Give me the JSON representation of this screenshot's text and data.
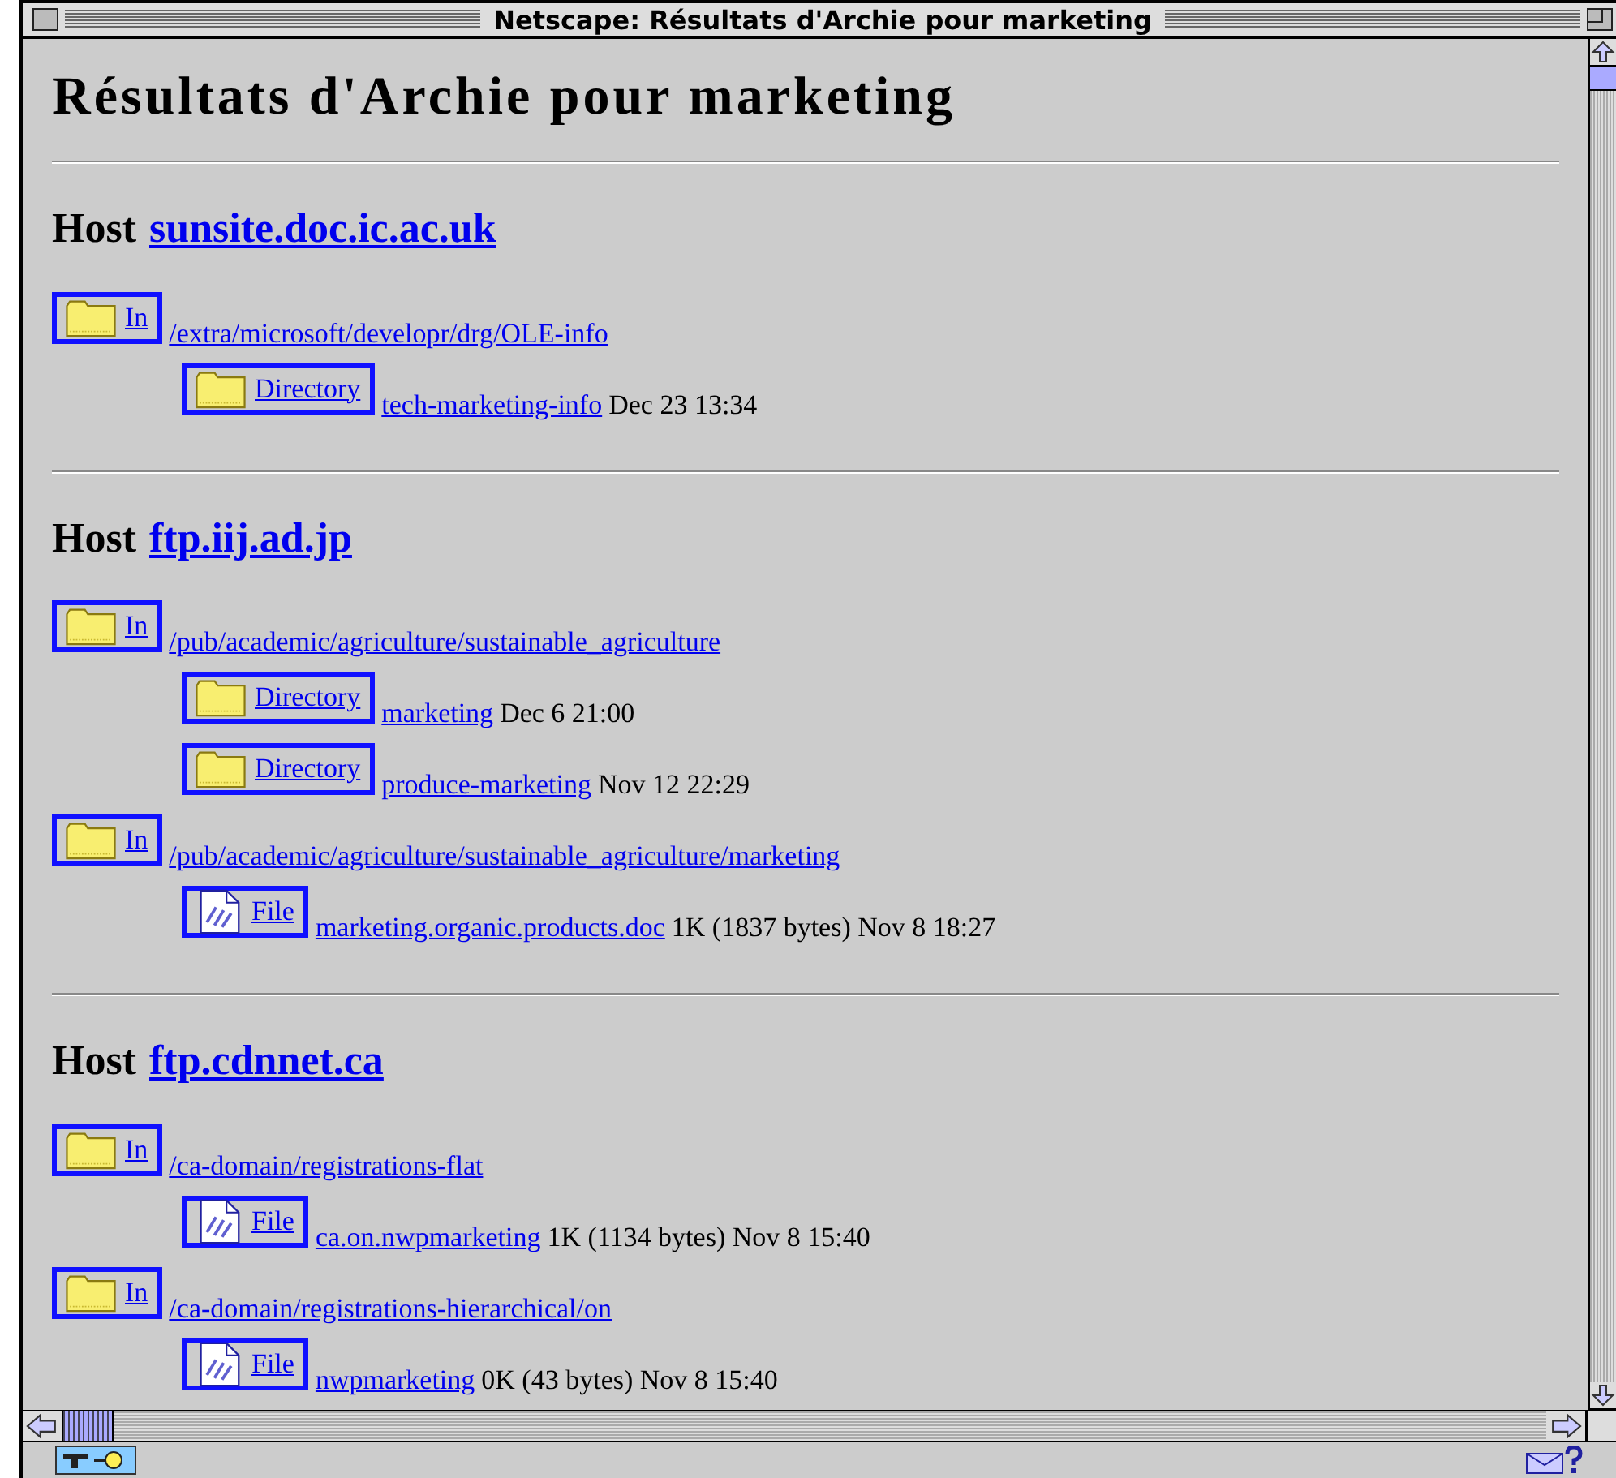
{
  "window": {
    "title": "Netscape: Résultats d'Archie pour marketing"
  },
  "heading": "Résultats d'Archie pour marketing",
  "hosts": [
    {
      "label": "Host",
      "name": "sunsite.doc.ic.ac.uk",
      "locations": [
        {
          "button": "In",
          "path": "/extra/microsoft/developr/drg/OLE-info",
          "items": [
            {
              "kind": "directory",
              "button": "Directory",
              "name": "tech-marketing-info",
              "info": "Dec 23 13:34"
            }
          ]
        }
      ]
    },
    {
      "label": "Host",
      "name": "ftp.iij.ad.jp",
      "locations": [
        {
          "button": "In",
          "path": "/pub/academic/agriculture/sustainable_agriculture",
          "items": [
            {
              "kind": "directory",
              "button": "Directory",
              "name": "marketing",
              "info": "Dec 6 21:00"
            },
            {
              "kind": "directory",
              "button": "Directory",
              "name": "produce-marketing",
              "info": "Nov 12 22:29"
            }
          ]
        },
        {
          "button": "In",
          "path": "/pub/academic/agriculture/sustainable_agriculture/marketing",
          "items": [
            {
              "kind": "file",
              "button": "File",
              "name": "marketing.organic.products.doc",
              "info": "1K (1837 bytes) Nov 8 18:27"
            }
          ]
        }
      ]
    },
    {
      "label": "Host",
      "name": "ftp.cdnnet.ca",
      "locations": [
        {
          "button": "In",
          "path": "/ca-domain/registrations-flat",
          "items": [
            {
              "kind": "file",
              "button": "File",
              "name": "ca.on.nwpmarketing",
              "info": "1K (1134 bytes) Nov 8 15:40"
            }
          ]
        },
        {
          "button": "In",
          "path": "/ca-domain/registrations-hierarchical/on",
          "items": [
            {
              "kind": "file",
              "button": "File",
              "name": "nwpmarketing",
              "info": "0K (43 bytes) Nov 8 15:40"
            }
          ]
        }
      ]
    }
  ]
}
